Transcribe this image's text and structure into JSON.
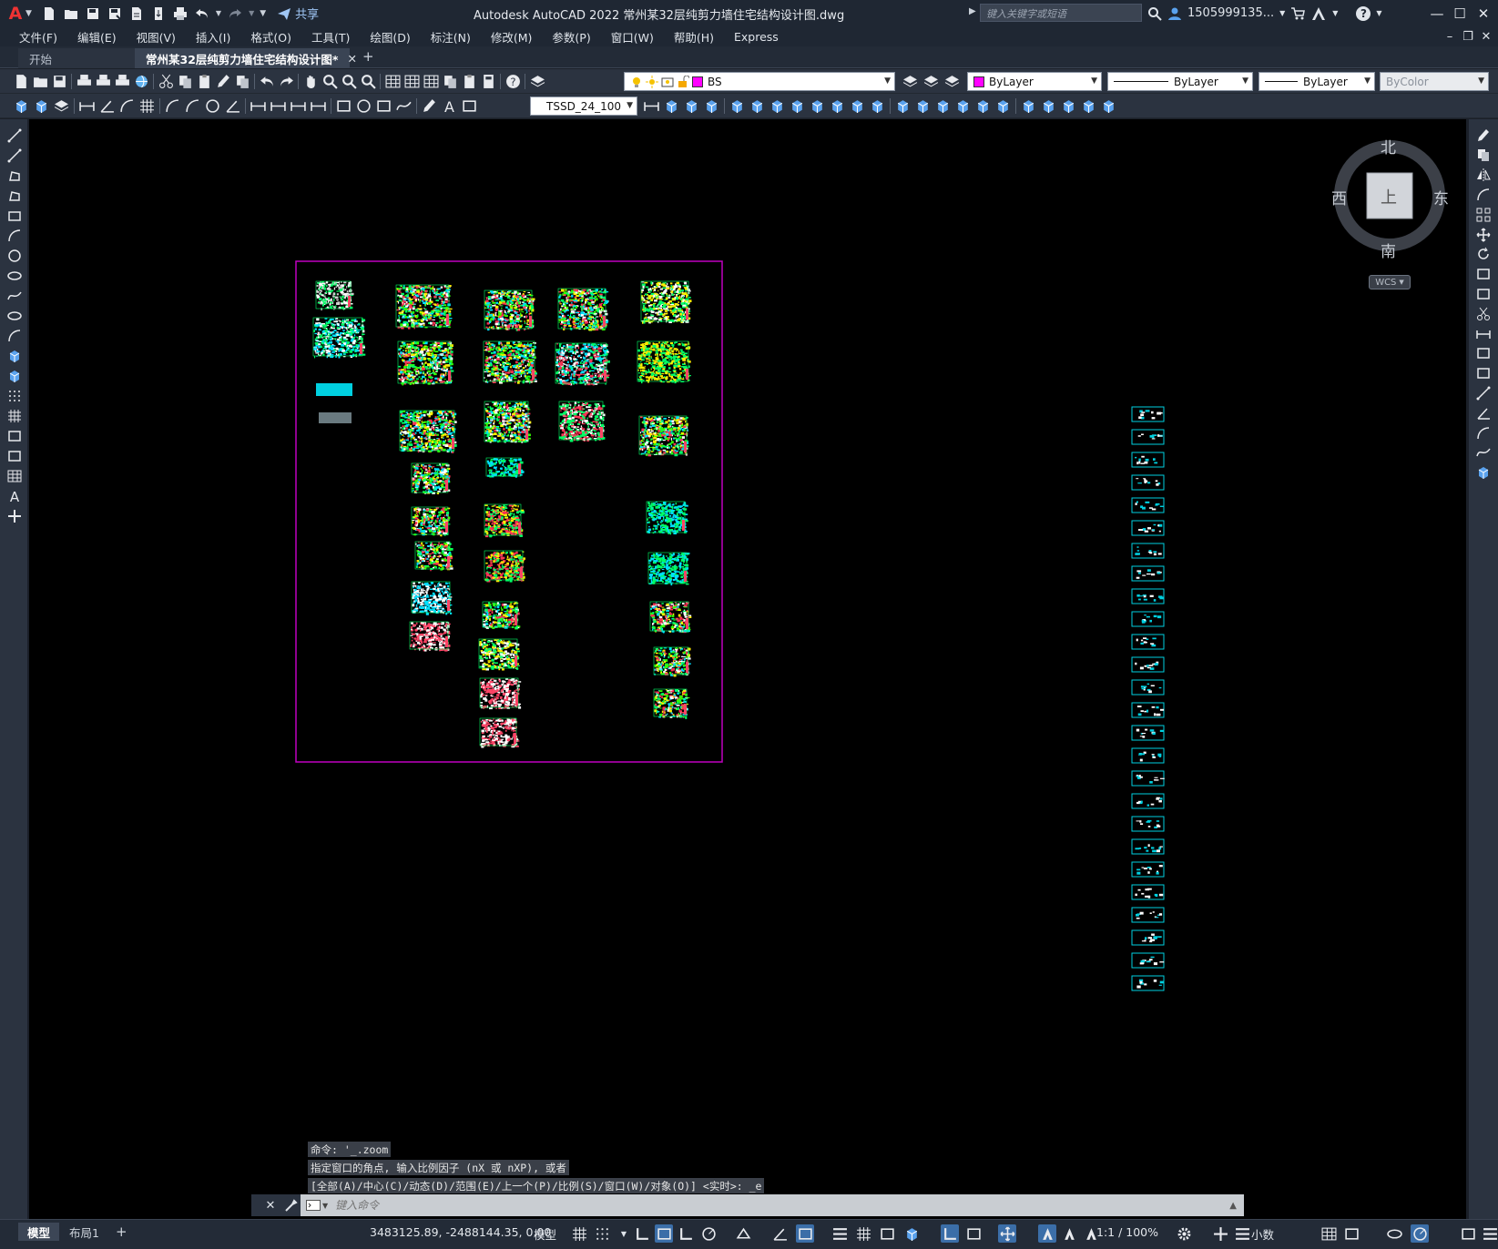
{
  "app": {
    "logo": "A",
    "window_title": "Autodesk AutoCAD 2022    常州某32层纯剪力墙住宅结构设计图.dwg",
    "share_label": "共享",
    "search_placeholder": "键入关键字或短语",
    "user": "1505999135...",
    "help": "?"
  },
  "window_controls": {
    "minimize": "—",
    "maximize": "☐",
    "close": "✕"
  },
  "mdi_controls": {
    "minimize": "–",
    "restore": "❐",
    "close": "✕"
  },
  "menu": [
    "文件(F)",
    "编辑(E)",
    "视图(V)",
    "插入(I)",
    "格式(O)",
    "工具(T)",
    "绘图(D)",
    "标注(N)",
    "修改(M)",
    "参数(P)",
    "窗口(W)",
    "帮助(H)",
    "Express"
  ],
  "tabs": {
    "start": "开始",
    "active": "常州某32层纯剪力墙住宅结构设计图*",
    "close": "✕",
    "add": "+"
  },
  "properties": {
    "layer": "BS",
    "layer_color": "#ff00ff",
    "color": "ByLayer",
    "color_swatch": "#ff00ff",
    "linetype": "ByLayer",
    "lineweight": "ByLayer",
    "plotstyle": "ByColor",
    "dimstyle": "TSSD_24_100"
  },
  "viewcube": {
    "north": "北",
    "south": "南",
    "east": "东",
    "west": "西",
    "top": "上",
    "wcs": "WCS"
  },
  "command": {
    "history": [
      "命令: '_.zoom",
      "指定窗口的角点, 输入比例因子 (nX 或 nXP), 或者",
      "[全部(A)/中心(C)/动态(D)/范围(E)/上一个(P)/比例(S)/窗口(W)/对象(O)] <实时>: _e"
    ],
    "placeholder": "键入命令"
  },
  "layout_tabs": {
    "model": "模型",
    "layout1": "布局1",
    "add": "+"
  },
  "status": {
    "coordinates": "3483125.89, -2488144.35, 0.00",
    "space": "模型",
    "scale": "1:1 / 100%",
    "units": "小数"
  },
  "colors": {
    "accent": "#3b6ea8",
    "canvas": "#000000",
    "frame": "#c000c0",
    "sheet_cyan": "#00d0e0"
  }
}
